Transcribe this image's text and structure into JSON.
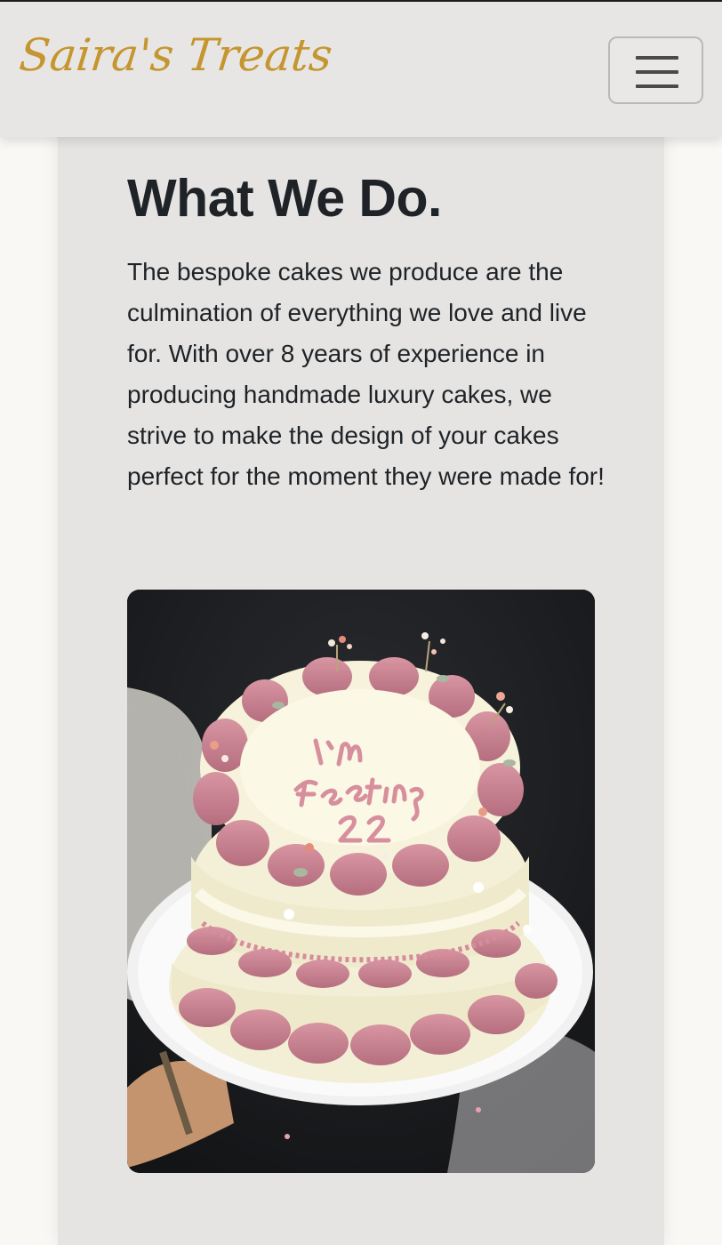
{
  "navbar": {
    "brand": "Saira's Treats",
    "menu_button_label": "Toggle navigation",
    "menu_icon": "hamburger-icon"
  },
  "section": {
    "title": "What We Do.",
    "body": "The bespoke cakes we produce are the culmination of everything we love and live for. With over 8 years of experience in producing handmade luxury cakes, we strive to make the design of your cakes perfect for the moment they were made for!"
  },
  "image": {
    "subject": "cake-photo",
    "cake_inscription": [
      "I'm",
      "Feeling",
      "22"
    ],
    "colors": {
      "frosting_pink": "#c9808f",
      "frosting_cream": "#f3efd6",
      "board": "#f4f4f4",
      "background": "#1c1d20"
    }
  },
  "colors": {
    "brand": "#c59630",
    "navbar_bg": "#e7e6e5",
    "card_bg": "#e5e4e3",
    "page_bg": "#f9f8f5",
    "text": "#1f2327"
  }
}
